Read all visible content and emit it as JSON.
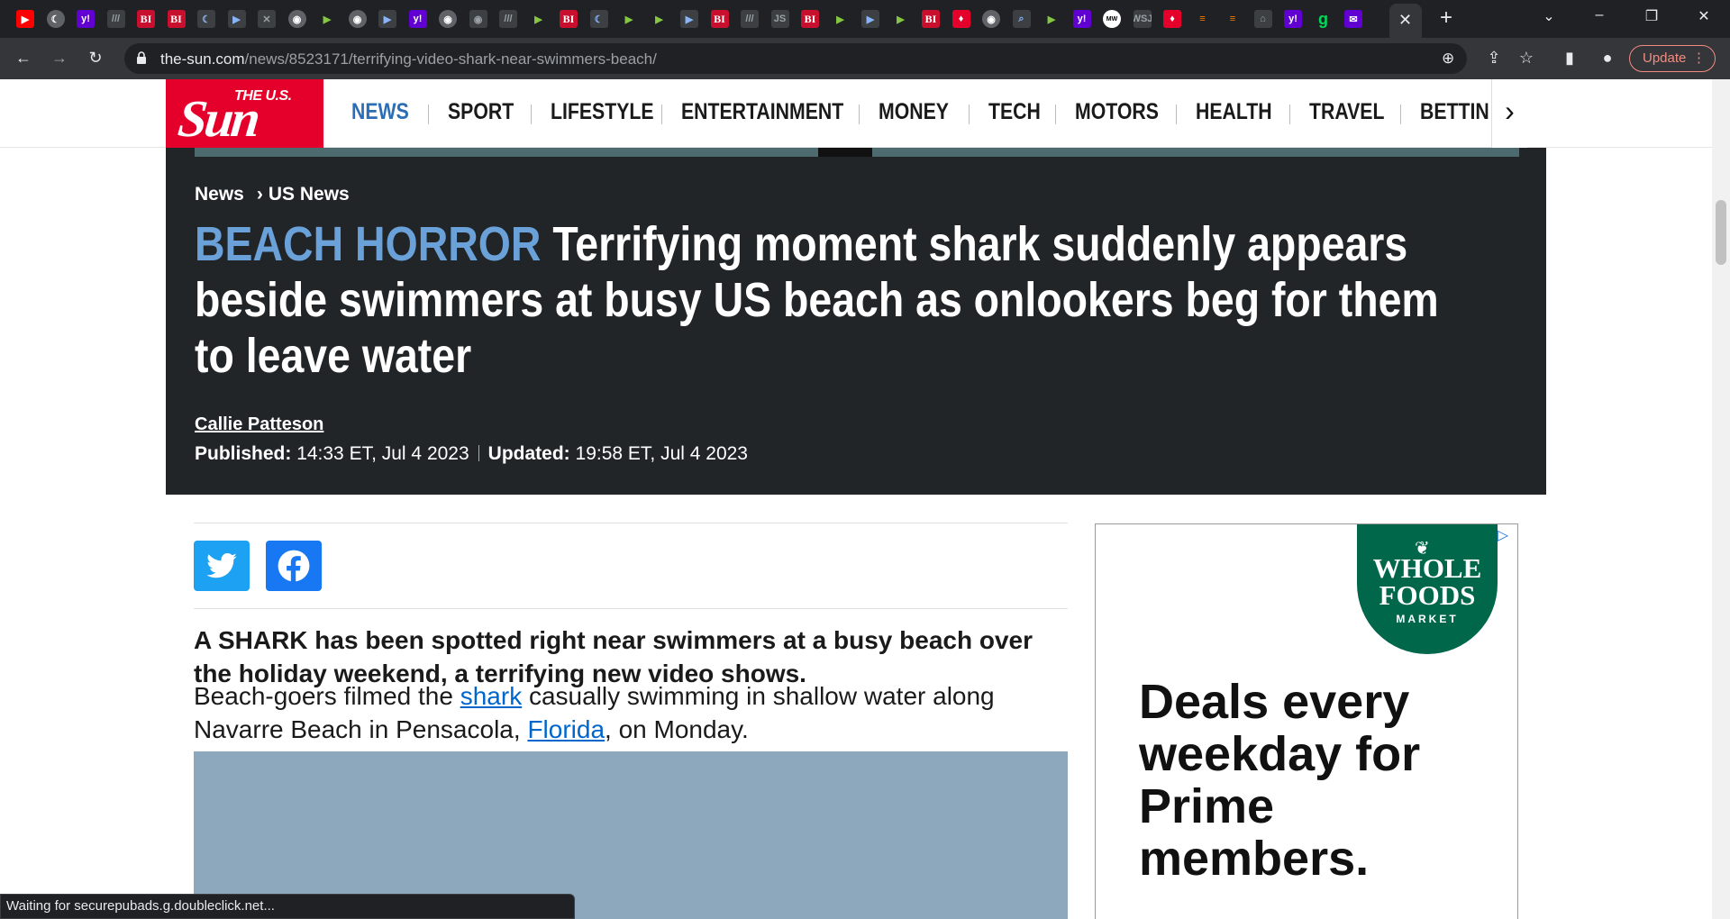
{
  "browser": {
    "tabs": [
      {
        "icon": "youtube-icon",
        "label": "▶"
      },
      {
        "icon": "globe-icon",
        "label": "☾"
      },
      {
        "icon": "yahoo-icon",
        "label": "y!"
      },
      {
        "icon": "wsj-icon",
        "label": "///"
      },
      {
        "icon": "business-insider-icon",
        "label": "BI"
      },
      {
        "icon": "business-insider-icon",
        "label": "BI"
      },
      {
        "icon": "crescent-icon",
        "label": "☾"
      },
      {
        "icon": "play-icon",
        "label": "▶"
      },
      {
        "icon": "sheet-icon",
        "label": "✕"
      },
      {
        "icon": "globe-icon",
        "label": "◉"
      },
      {
        "icon": "rumble-icon",
        "label": "▶"
      },
      {
        "icon": "globe-icon",
        "label": "◉"
      },
      {
        "icon": "play-icon",
        "label": "▶"
      },
      {
        "icon": "yahoo-icon",
        "label": "y!"
      },
      {
        "icon": "globe-icon",
        "label": "◉"
      },
      {
        "icon": "starbucks-icon",
        "label": "◉"
      },
      {
        "icon": "wsj-icon",
        "label": "///"
      },
      {
        "icon": "rumble-icon",
        "label": "▶"
      },
      {
        "icon": "business-insider-icon",
        "label": "BI"
      },
      {
        "icon": "crescent-icon",
        "label": "☾"
      },
      {
        "icon": "rumble-icon",
        "label": "▶"
      },
      {
        "icon": "rumble-icon",
        "label": "▶"
      },
      {
        "icon": "play-icon",
        "label": "▶"
      },
      {
        "icon": "business-insider-icon",
        "label": "BI"
      },
      {
        "icon": "wsj-icon",
        "label": "///"
      },
      {
        "icon": "js-icon",
        "label": "JS"
      },
      {
        "icon": "business-insider-icon",
        "label": "BI"
      },
      {
        "icon": "rumble-icon",
        "label": "▶"
      },
      {
        "icon": "play-icon",
        "label": "▶"
      },
      {
        "icon": "rumble-icon",
        "label": "▶"
      },
      {
        "icon": "business-insider-icon",
        "label": "BI"
      },
      {
        "icon": "the-sun-icon",
        "label": "♦"
      },
      {
        "icon": "globe-icon",
        "label": "◉"
      },
      {
        "icon": "search-icon",
        "label": "⌕"
      },
      {
        "icon": "rumble-icon",
        "label": "▶"
      },
      {
        "icon": "yahoo-icon",
        "label": "y!"
      },
      {
        "icon": "marketwatch-icon",
        "label": "MW"
      },
      {
        "icon": "wsj-icon",
        "label": "WSJ"
      },
      {
        "icon": "the-sun-icon",
        "label": "♦"
      },
      {
        "icon": "bookmark-icon",
        "label": "≡"
      },
      {
        "icon": "bookmark-icon",
        "label": "≡"
      },
      {
        "icon": "home-icon",
        "label": "⌂"
      },
      {
        "icon": "yahoo-icon",
        "label": "y!"
      },
      {
        "icon": "grammarly-icon",
        "label": "g"
      },
      {
        "icon": "yahoo-mail-icon",
        "label": "✉"
      }
    ],
    "url_host": "the-sun.com",
    "url_path": "/news/8523171/terrifying-video-shark-near-swimmers-beach/",
    "update_label": "Update",
    "status_text": "Waiting for securepubads.g.doubleclick.net..."
  },
  "site": {
    "logo_small": "THE U.S.",
    "logo_big": "Sun",
    "nav": [
      "NEWS",
      "SPORT",
      "LIFESTYLE",
      "ENTERTAINMENT",
      "MONEY",
      "TECH",
      "MOTORS",
      "HEALTH",
      "TRAVEL",
      "BETTIN"
    ],
    "active_color": "#2c6eb5"
  },
  "article": {
    "breadcrumb": [
      "News",
      "US News"
    ],
    "kicker": "BEACH HORROR",
    "headline": "Terrifying moment shark suddenly appears beside swimmers at busy US beach as onlookers beg for them to leave water",
    "author": "Callie Patteson",
    "published_label": "Published:",
    "published_value": "14:33 ET, Jul 4 2023",
    "updated_label": "Updated:",
    "updated_value": "19:58 ET, Jul 4 2023",
    "lead": "A SHARK has been spotted right near swimmers at a busy beach over the holiday weekend, a terrifying new video shows.",
    "para_a": "Beach-goers filmed the ",
    "para_link1": "shark",
    "para_b": " casually swimming in shallow water along Navarre Beach in Pensacola, ",
    "para_link2": "Florida",
    "para_c": ", on Monday."
  },
  "ad": {
    "logo_line1": "WHOLE",
    "logo_line2": "FOODS",
    "logo_line3": "MARKET",
    "copy": "Deals every weekday for Prime members.",
    "choices_icon": "▷"
  }
}
